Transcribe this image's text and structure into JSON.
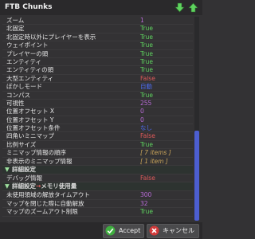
{
  "window": {
    "title": "FTB Chunks"
  },
  "colors": {
    "true": "#5fd35f",
    "false": "#e05a5a",
    "number": "#b86bd6",
    "mode": "#4e6cf0",
    "count": "#c9a45a",
    "accent": "#4c5ed0"
  },
  "rows": [
    {
      "label": "ズーム",
      "value": "1",
      "type": "number"
    },
    {
      "label": "北固定",
      "value": "True",
      "type": "true"
    },
    {
      "label": "北固定時以外にプレイヤーを表示",
      "value": "True",
      "type": "true"
    },
    {
      "label": "ウェイポイント",
      "value": "True",
      "type": "true"
    },
    {
      "label": "プレイヤーの頭",
      "value": "True",
      "type": "true"
    },
    {
      "label": "エンティティ",
      "value": "True",
      "type": "true"
    },
    {
      "label": "エンティティの頭",
      "value": "True",
      "type": "true"
    },
    {
      "label": "大型エンティティ",
      "value": "False",
      "type": "false"
    },
    {
      "label": "ぼかしモード",
      "value": "自動",
      "type": "mode"
    },
    {
      "label": "コンパス",
      "value": "True",
      "type": "true"
    },
    {
      "label": "可視性",
      "value": "255",
      "type": "number"
    },
    {
      "label": "位置オフセット X",
      "value": "0",
      "type": "number"
    },
    {
      "label": "位置オフセット Y",
      "value": "0",
      "type": "number"
    },
    {
      "label": "位置オフセット条件",
      "value": "なし",
      "type": "mode"
    },
    {
      "label": "四角いミニマップ",
      "value": "False",
      "type": "false"
    },
    {
      "label": "比例サイズ",
      "value": "True",
      "type": "true"
    },
    {
      "label": "ミニマップ情報の順序",
      "value": "[ 7 items ]",
      "type": "count"
    },
    {
      "label": "非表示のミニマップ情報",
      "value": "[ 1 item ]",
      "type": "count"
    }
  ],
  "sections": {
    "advanced": {
      "label": "詳細設定"
    },
    "memory": {
      "label_a": "詳細設定",
      "arrow": "→",
      "label_b": "メモリ使用量"
    }
  },
  "advanced_rows": [
    {
      "label": "デバッグ情報",
      "value": "False",
      "type": "false"
    }
  ],
  "memory_rows": [
    {
      "label": "未使用領域の解放タイムアウト",
      "value": "300",
      "type": "number"
    },
    {
      "label": "マップを閉じた際に自動解放",
      "value": "32",
      "type": "number"
    },
    {
      "label": "マップのズームアウト制限",
      "value": "True",
      "type": "true"
    }
  ],
  "scrollbar": {
    "position_fraction": 0.56,
    "thumb_fraction": 0.44
  },
  "buttons": {
    "accept": "Accept",
    "cancel": "キャンセル"
  }
}
